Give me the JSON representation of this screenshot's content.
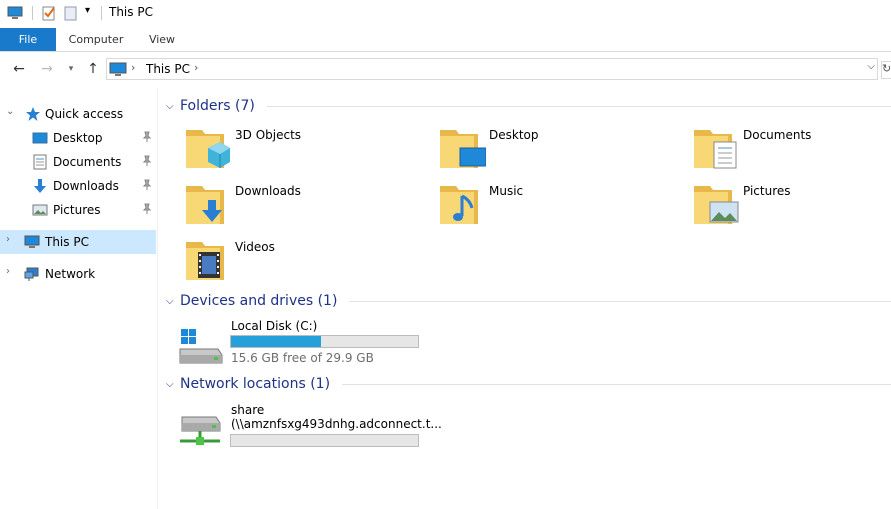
{
  "window": {
    "title": "This PC"
  },
  "ribbon": {
    "tabs": [
      "File",
      "Computer",
      "View"
    ]
  },
  "address": {
    "path": "This PC"
  },
  "sidebar": {
    "quick_access": "Quick access",
    "pinned": [
      {
        "label": "Desktop",
        "icon": "desktop-icon"
      },
      {
        "label": "Documents",
        "icon": "documents-icon"
      },
      {
        "label": "Downloads",
        "icon": "downloads-icon"
      },
      {
        "label": "Pictures",
        "icon": "pictures-icon"
      }
    ],
    "this_pc": "This PC",
    "network": "Network"
  },
  "groups": {
    "folders": "Folders (7)",
    "devices": "Devices and drives (1)",
    "network": "Network locations (1)"
  },
  "folders": [
    {
      "label": "3D Objects",
      "icon": "3d-objects-folder-icon"
    },
    {
      "label": "Desktop",
      "icon": "desktop-folder-icon"
    },
    {
      "label": "Documents",
      "icon": "documents-folder-icon"
    },
    {
      "label": "Downloads",
      "icon": "downloads-folder-icon"
    },
    {
      "label": "Music",
      "icon": "music-folder-icon"
    },
    {
      "label": "Pictures",
      "icon": "pictures-folder-icon"
    },
    {
      "label": "Videos",
      "icon": "videos-folder-icon"
    }
  ],
  "drives": [
    {
      "name": "Local Disk (C:)",
      "free": "15.6 GB free of 29.9 GB",
      "used_fraction": 0.48
    }
  ],
  "network_locations": [
    {
      "name": "share",
      "path": "(\\\\amznfsxg493dnhg.adconnect.t...",
      "used_fraction": 0
    }
  ],
  "colors": {
    "accent": "#1979ca",
    "selected": "#cce8ff",
    "group_title": "#1e3287",
    "bar_fill": "#26a0da"
  }
}
